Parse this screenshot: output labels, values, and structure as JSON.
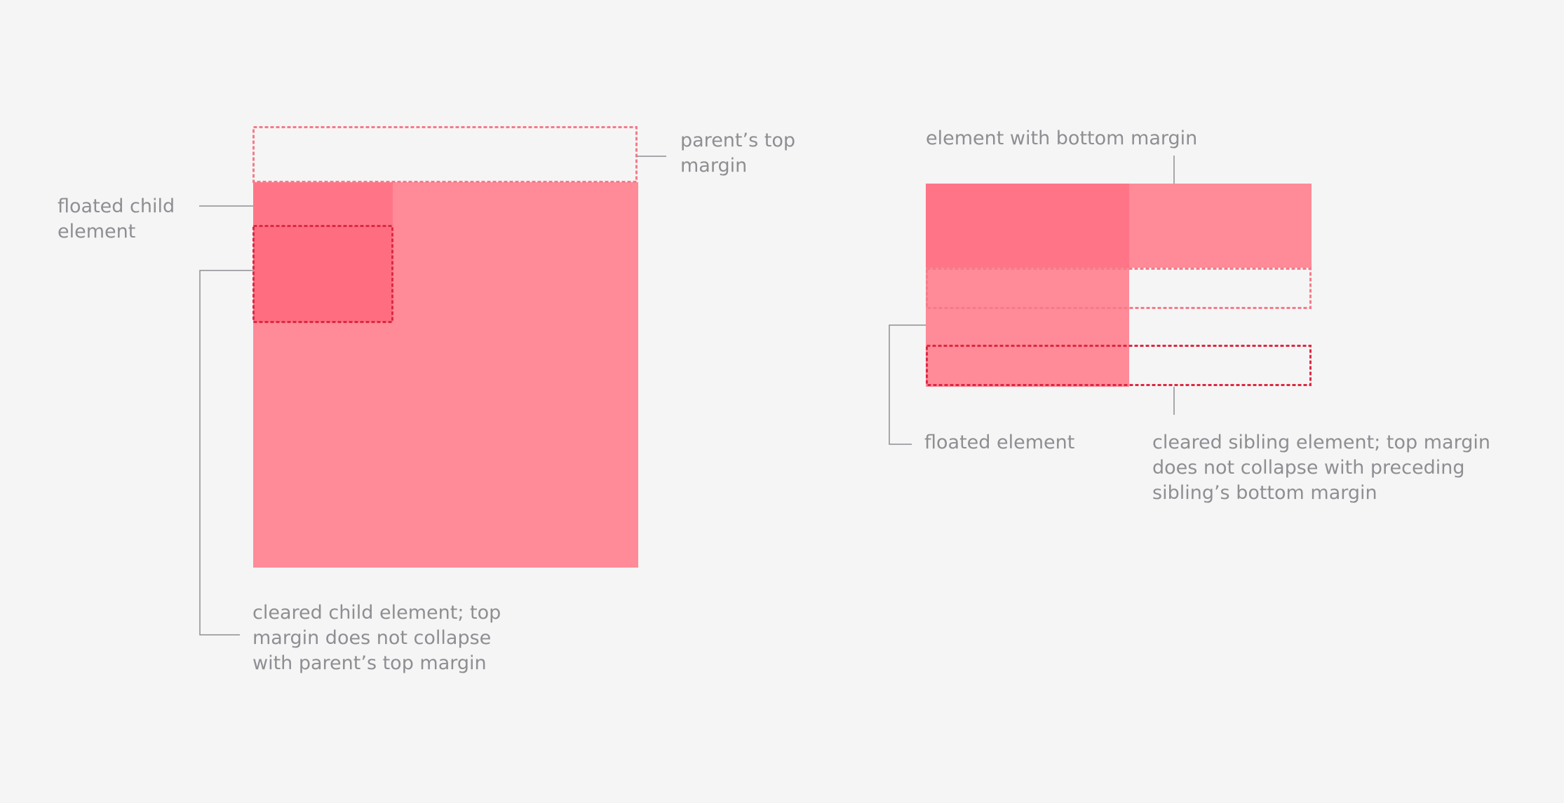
{
  "colors": {
    "background": "#f5f5f5",
    "box_fill": "#ff8a98",
    "float_fill": "#ff7587",
    "cleared_child_fill": "#ff6e80",
    "margin_outline": "#f47b89",
    "cleared_outline": "#dc2842",
    "leader_line": "#8e8e93",
    "label_text": "#8e8e93"
  },
  "left_diagram": {
    "parent_margin_label": [
      "parent’s top",
      "margin"
    ],
    "floated_child_label": [
      "floated child",
      "element"
    ],
    "cleared_child_label": [
      "cleared child element; top",
      "margin does not collapse",
      "with parent’s top margin"
    ]
  },
  "right_diagram": {
    "bottom_margin_label": [
      "element with bottom margin"
    ],
    "floated_element_label": [
      "floated element"
    ],
    "cleared_sibling_label": [
      "cleared sibling element; top margin",
      "does not collapse with preceding",
      "sibling’s bottom margin"
    ]
  }
}
